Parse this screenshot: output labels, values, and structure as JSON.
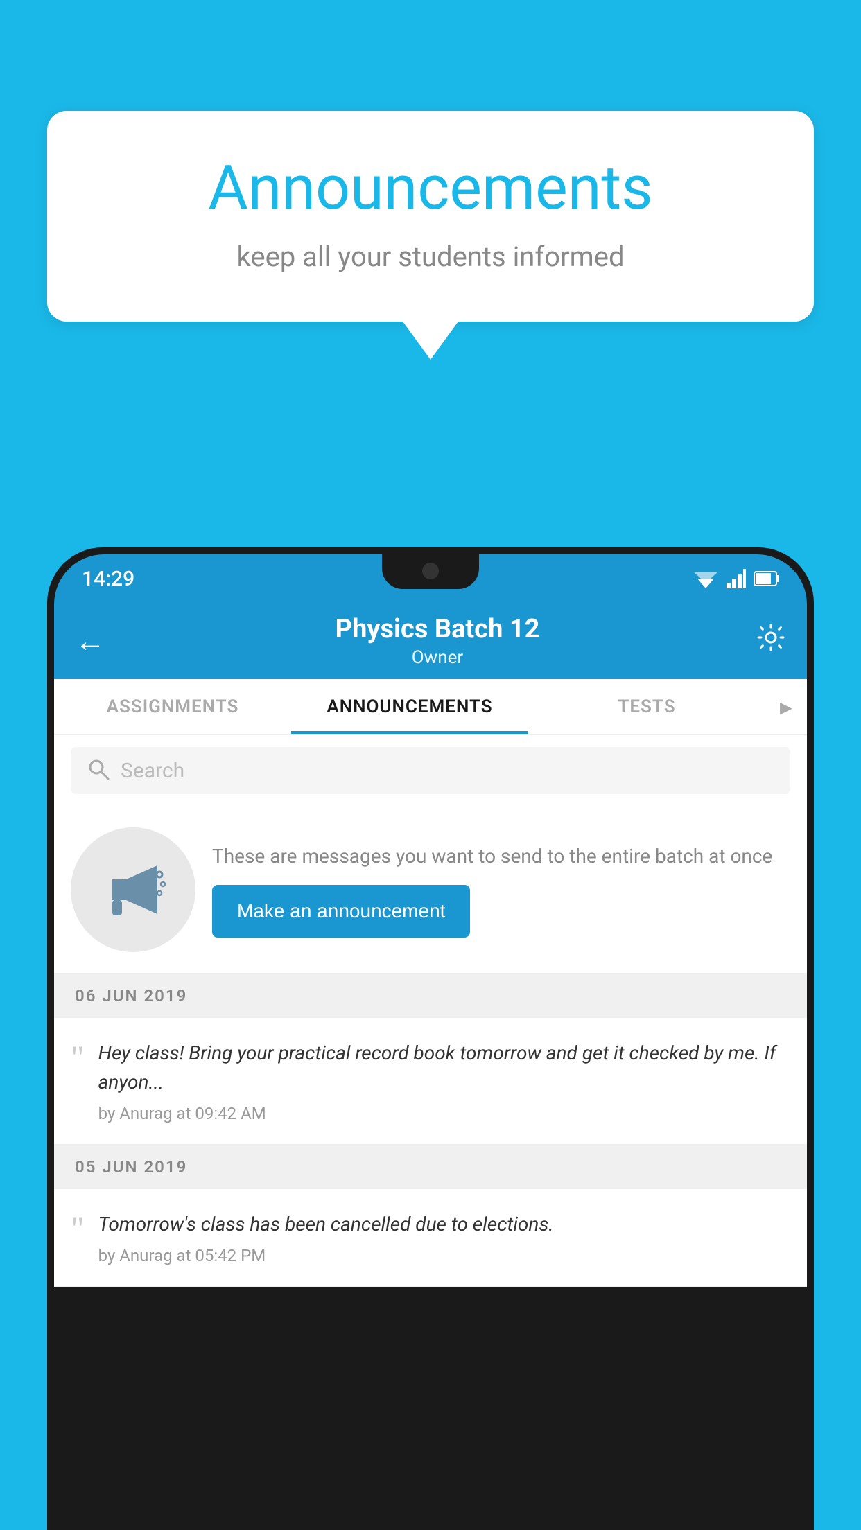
{
  "background_color": "#1ab8e8",
  "speech_bubble": {
    "title": "Announcements",
    "subtitle": "keep all your students informed"
  },
  "status_bar": {
    "time": "14:29",
    "wifi": "▲",
    "signal": "▲",
    "battery": "▮"
  },
  "app_bar": {
    "title": "Physics Batch 12",
    "subtitle": "Owner",
    "back_label": "←",
    "settings_label": "⚙"
  },
  "tabs": [
    {
      "label": "ASSIGNMENTS",
      "active": false
    },
    {
      "label": "ANNOUNCEMENTS",
      "active": true
    },
    {
      "label": "TESTS",
      "active": false
    },
    {
      "label": "·",
      "active": false
    }
  ],
  "search": {
    "placeholder": "Search"
  },
  "promo": {
    "text": "These are messages you want to send to the entire batch at once",
    "button_label": "Make an announcement"
  },
  "announcements": [
    {
      "date": "06  JUN  2019",
      "message": "Hey class! Bring your practical record book tomorrow and get it checked by me. If anyon...",
      "meta": "by Anurag at 09:42 AM"
    },
    {
      "date": "05  JUN  2019",
      "message": "Tomorrow's class has been cancelled due to elections.",
      "meta": "by Anurag at 05:42 PM"
    }
  ]
}
